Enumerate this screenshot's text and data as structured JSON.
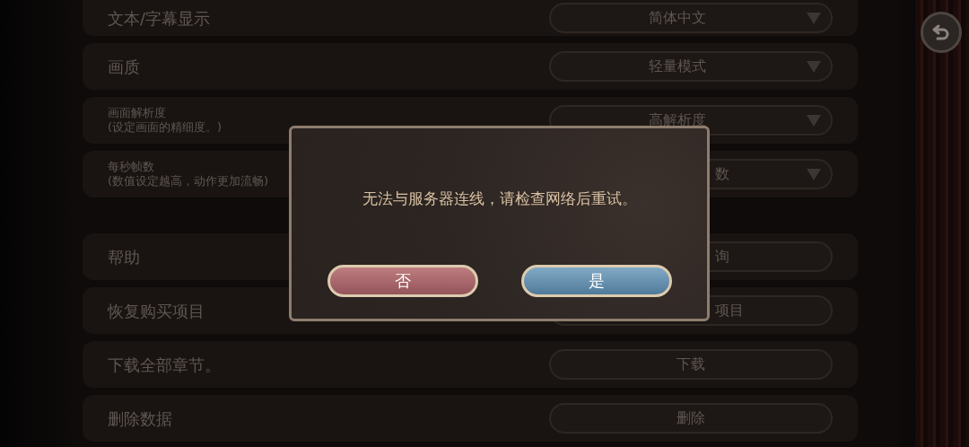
{
  "settings": [
    {
      "kind": "dropdown",
      "label": "文本/字幕显示",
      "value": "简体中文"
    },
    {
      "kind": "dropdown",
      "label": "画质",
      "value": "轻量模式"
    },
    {
      "kind": "dropdown",
      "label": "画面解析度",
      "note": "(设定画面的精细度。)",
      "value": "高解析度"
    },
    {
      "kind": "dropdown",
      "label": "每秒帧数",
      "note": "(数值设定越高，动作更加流畅)",
      "value": "数",
      "covered": true
    }
  ],
  "actions": [
    {
      "label": "帮助",
      "button": "询",
      "covered": true
    },
    {
      "label": "恢复购买项目",
      "button": "项目",
      "covered": true
    },
    {
      "label": "下载全部章节。",
      "button": "下载"
    },
    {
      "label": "删除数据",
      "button": "删除"
    }
  ],
  "dialog": {
    "message": "无法与服务器连线，请检查网络后重试。",
    "buttons": [
      {
        "label": "否",
        "kind": "no"
      },
      {
        "label": "是",
        "kind": "yes"
      }
    ]
  }
}
